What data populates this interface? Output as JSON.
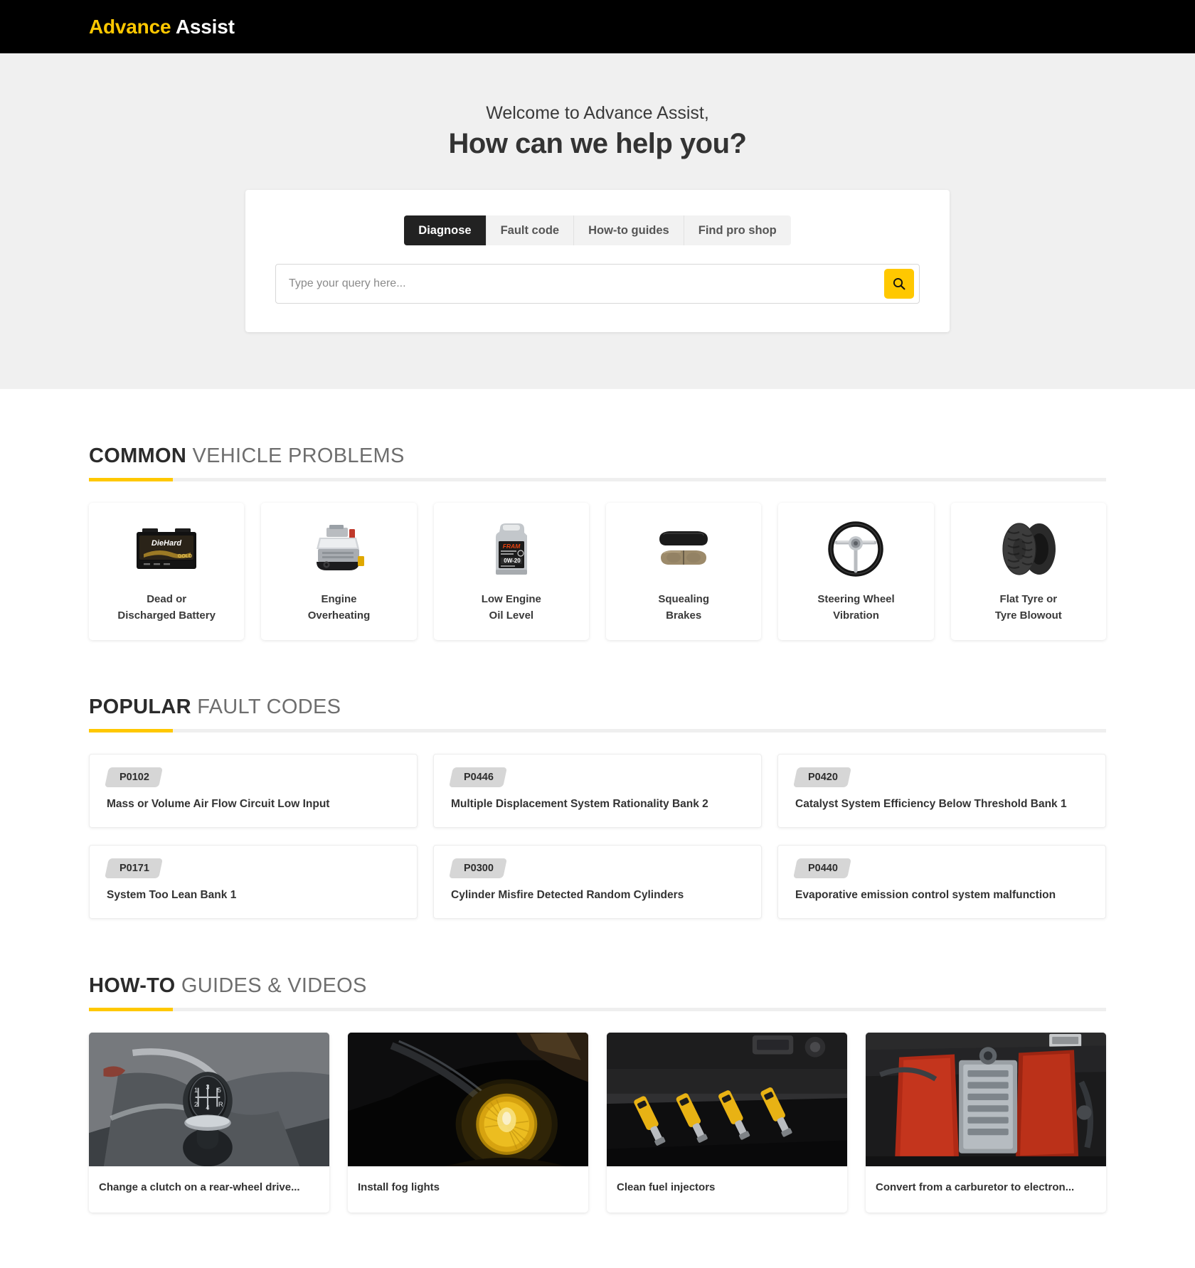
{
  "header": {
    "brand_first": "Advance",
    "brand_second": "Assist"
  },
  "hero": {
    "welcome": "Welcome to Advance Assist,",
    "title": "How can we help you?",
    "tabs": [
      {
        "label": "Diagnose",
        "active": true
      },
      {
        "label": "Fault code",
        "active": false
      },
      {
        "label": "How-to guides",
        "active": false
      },
      {
        "label": "Find pro shop",
        "active": false
      }
    ],
    "search": {
      "placeholder": "Type your query here...",
      "value": "",
      "button_icon": "search-icon"
    }
  },
  "sections": {
    "problems": {
      "head_strong": "COMMON",
      "head_light": " VEHICLE PROBLEMS",
      "items": [
        {
          "label_line1": "Dead or",
          "label_line2": "Discharged Battery",
          "icon": "car-battery-image"
        },
        {
          "label_line1": "Engine",
          "label_line2": "Overheating",
          "icon": "engine-block-image"
        },
        {
          "label_line1": "Low Engine",
          "label_line2": "Oil Level",
          "icon": "motor-oil-jug-image"
        },
        {
          "label_line1": "Squealing",
          "label_line2": "Brakes",
          "icon": "brake-pads-image"
        },
        {
          "label_line1": "Steering Wheel",
          "label_line2": "Vibration",
          "icon": "steering-wheel-image"
        },
        {
          "label_line1": "Flat Tyre or",
          "label_line2": "Tyre Blowout",
          "icon": "tyre-image"
        }
      ]
    },
    "fault_codes": {
      "head_strong": "POPULAR",
      "head_light": " FAULT CODES",
      "items": [
        {
          "code": "P0102",
          "desc": "Mass or Volume Air Flow Circuit Low Input"
        },
        {
          "code": "P0446",
          "desc": "Multiple Displacement System Rationality Bank 2"
        },
        {
          "code": "P0420",
          "desc": "Catalyst System Efficiency Below Threshold Bank 1"
        },
        {
          "code": "P0171",
          "desc": "System Too Lean Bank 1"
        },
        {
          "code": "P0300",
          "desc": "Cylinder Misfire Detected Random Cylinders"
        },
        {
          "code": "P0440",
          "desc": "Evaporative emission control system malfunction"
        }
      ]
    },
    "guides": {
      "head_strong": "HOW-TO",
      "head_light": " GUIDES & VIDEOS",
      "items": [
        {
          "caption": "Change a clutch on a rear-wheel drive...",
          "thumb": "gear-shifter-photo"
        },
        {
          "caption": "Install fog lights",
          "thumb": "fog-light-photo"
        },
        {
          "caption": "Clean fuel injectors",
          "thumb": "fuel-injectors-photo"
        },
        {
          "caption": "Convert from a carburetor to electron...",
          "thumb": "engine-bay-photo"
        }
      ]
    }
  },
  "colors": {
    "accent_yellow": "#ffc800",
    "header_black": "#000000",
    "hero_bg": "#f0f0f0",
    "tab_active_bg": "#222222",
    "badge_bg": "#d6d6d6"
  }
}
